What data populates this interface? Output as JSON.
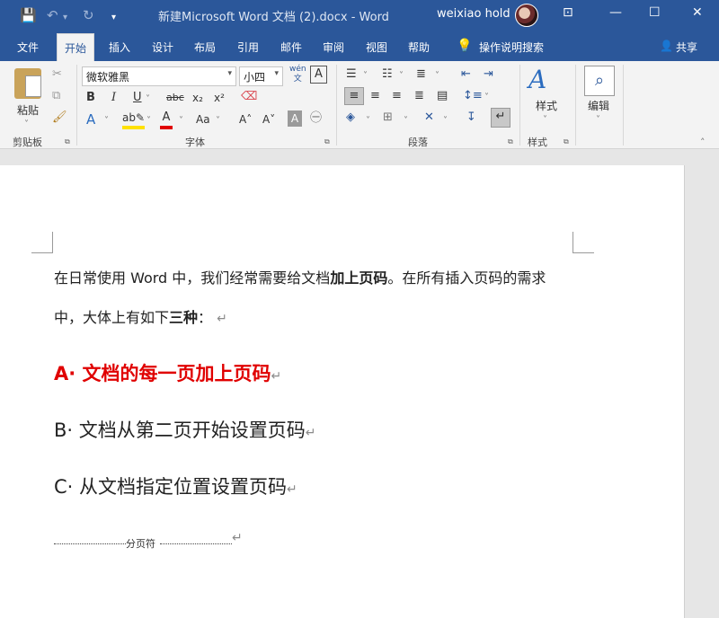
{
  "titlebar": {
    "title": "新建Microsoft Word 文档 (2).docx  -  Word",
    "user": "weixiao hold"
  },
  "tabs": {
    "file": "文件",
    "home": "开始",
    "insert": "插入",
    "design": "设计",
    "layout": "布局",
    "references": "引用",
    "mailings": "邮件",
    "review": "审阅",
    "view": "视图",
    "help": "帮助",
    "tell_me": "操作说明搜索",
    "share": "共享"
  },
  "ribbon": {
    "clipboard": {
      "paste_label": "粘贴",
      "group_label": "剪贴板"
    },
    "font": {
      "font_name": "微软雅黑",
      "font_size": "小四",
      "group_label": "字体",
      "bold": "B",
      "italic": "I",
      "underline": "U",
      "strike": "abc",
      "subscript": "x₂",
      "superscript": "x²",
      "grow": "A˄",
      "shrink": "A˅",
      "case": "Aa",
      "phonetic": "wén\n文",
      "char_border": "A"
    },
    "paragraph": {
      "group_label": "段落"
    },
    "styles": {
      "label": "样式",
      "group_label": "样式"
    },
    "editing": {
      "label": "编辑"
    }
  },
  "document": {
    "para1_part1": "在日常使用 Word 中，我们经常需要给文档",
    "para1_bold": "加上页码",
    "para1_part2": "。在所有插入页码的需求",
    "para2_part1": "中，大体上有如下",
    "para2_bold": "三种",
    "para2_part2": "：",
    "item_a": "A· 文档的每一页加上页码",
    "item_b": "B· 文档从第二页开始设置页码",
    "item_c": "C· 从文档指定位置设置页码",
    "page_break": "分页符",
    "return_mark": "↵"
  },
  "colors": {
    "brand": "#2b579a",
    "red_item": "#e00000"
  }
}
